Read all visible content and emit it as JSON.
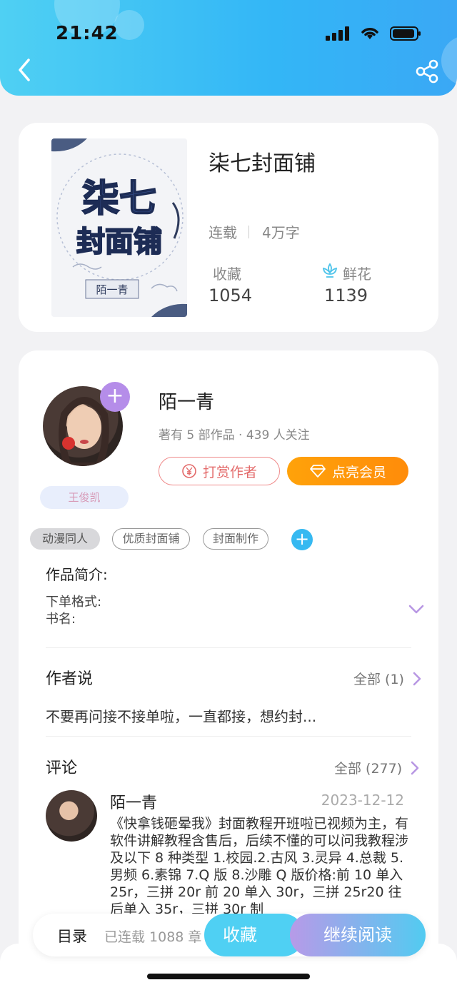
{
  "status": {
    "time": "21:42"
  },
  "book": {
    "title": "柒七封面铺",
    "status": "连载",
    "word_count": "4万字",
    "favorites_label": "收藏",
    "favorites_value": "1054",
    "flowers_label": "鲜花",
    "flowers_value": "1139",
    "cover": {
      "title_line1": "柒七",
      "title_line2": "封面铺",
      "author": "陌一青"
    }
  },
  "author": {
    "name": "陌一青",
    "stats": "著有 5 部作品 · 439 人关注",
    "fan_badge": "王俊凯",
    "reward_label": "打赏作者",
    "vip_label": "点亮会员"
  },
  "tags": [
    "动漫同人",
    "优质封面铺",
    "封面制作"
  ],
  "intro": {
    "title": "作品简介:",
    "line1": "下单格式:",
    "line2": "书名:"
  },
  "author_say": {
    "title": "作者说",
    "all_label": "全部 (1)",
    "text": "不要再问接不接单啦，一直都接，想约封..."
  },
  "comments": {
    "title": "评论",
    "all_label": "全部 (277)",
    "first": {
      "name": "陌一青",
      "date": "2023-12-12",
      "text": "《快拿钱砸晕我》封面教程开班啦已视频为主，有软件讲解教程含售后，后续不懂的可以问我教程涉及以下 8 种类型 1.校园.2.古风 3.灵异 4.总裁 5.男频 6.素锦 7.Q 版 8.沙雕 Q 版价格:前 10 单入 25r，三拼 20r 前 20 单入 30r，三拼 25r20 往后单入 35r，三拼 30r 制"
    }
  },
  "bottom_bar": {
    "toc_label": "目录",
    "chapters_label": "已连载 1088 章",
    "favorite_label": "收藏",
    "continue_label": "继续阅读"
  },
  "colors": {
    "header_gradient_start": "#4fd0f3",
    "header_gradient_end": "#3aa8f5",
    "vip_orange": "#ff9a0a",
    "reward_red": "#e36a6a",
    "plus_purple": "#b58de9",
    "tag_add_blue": "#36b9f1"
  }
}
